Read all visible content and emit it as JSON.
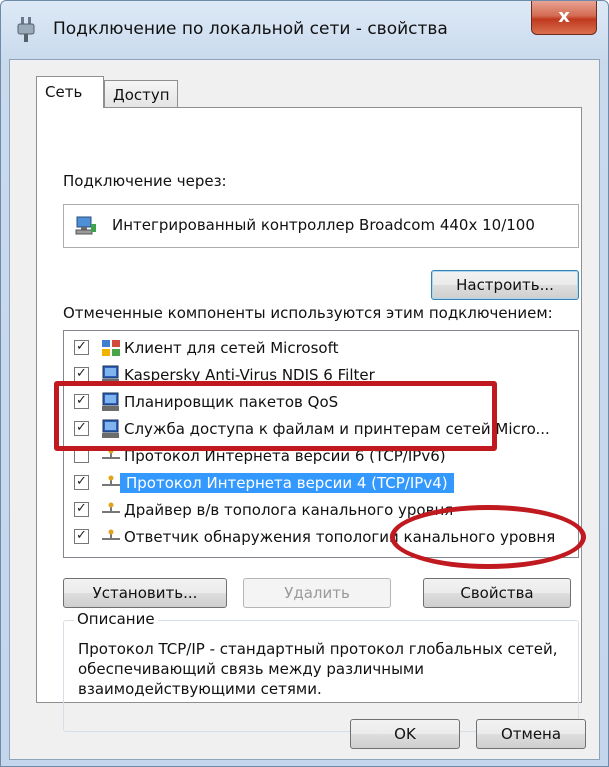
{
  "window": {
    "title": "Подключение по локальной сети - свойства",
    "close_glyph": "x"
  },
  "tabs": [
    {
      "label": "Сеть",
      "active": true
    },
    {
      "label": "Доступ",
      "active": false
    }
  ],
  "connect_label": "Подключение через:",
  "adapter_name": "Интегрированный контроллер Broadcom 440x 10/100",
  "configure_button": "Настроить...",
  "components_label": "Отмеченные компоненты используются этим подключением:",
  "components": [
    {
      "label": "Клиент для сетей Microsoft",
      "checked": true,
      "icon": "network-client-icon"
    },
    {
      "label": "Kaspersky Anti-Virus NDIS 6 Filter",
      "checked": true,
      "icon": "computer-icon"
    },
    {
      "label": "Планировщик пакетов QoS",
      "checked": true,
      "icon": "computer-icon"
    },
    {
      "label": "Служба доступа к файлам и принтерам сетей Micro...",
      "checked": true,
      "icon": "computer-icon"
    },
    {
      "label": "Протокол Интернета версии 6 (TCP/IPv6)",
      "checked": false,
      "icon": "protocol-icon"
    },
    {
      "label": "Протокол Интернета версии 4 (TCP/IPv4)",
      "checked": true,
      "icon": "protocol-icon",
      "selected": true
    },
    {
      "label": "Драйвер в/в тополога канального уровня",
      "checked": true,
      "icon": "protocol-icon"
    },
    {
      "label": "Ответчик обнаружения топологии канального уровня",
      "checked": true,
      "icon": "protocol-icon"
    }
  ],
  "buttons": {
    "install": "Установить...",
    "remove": "Удалить",
    "properties": "Свойства",
    "ok": "OK",
    "cancel": "Отмена"
  },
  "description": {
    "title": "Описание",
    "text": "Протокол TCP/IP - стандартный протокол глобальных сетей, обеспечивающий связь между различными взаимодействующими сетями."
  },
  "colors": {
    "selection": "#3399ff",
    "annotation": "#c0191f"
  }
}
